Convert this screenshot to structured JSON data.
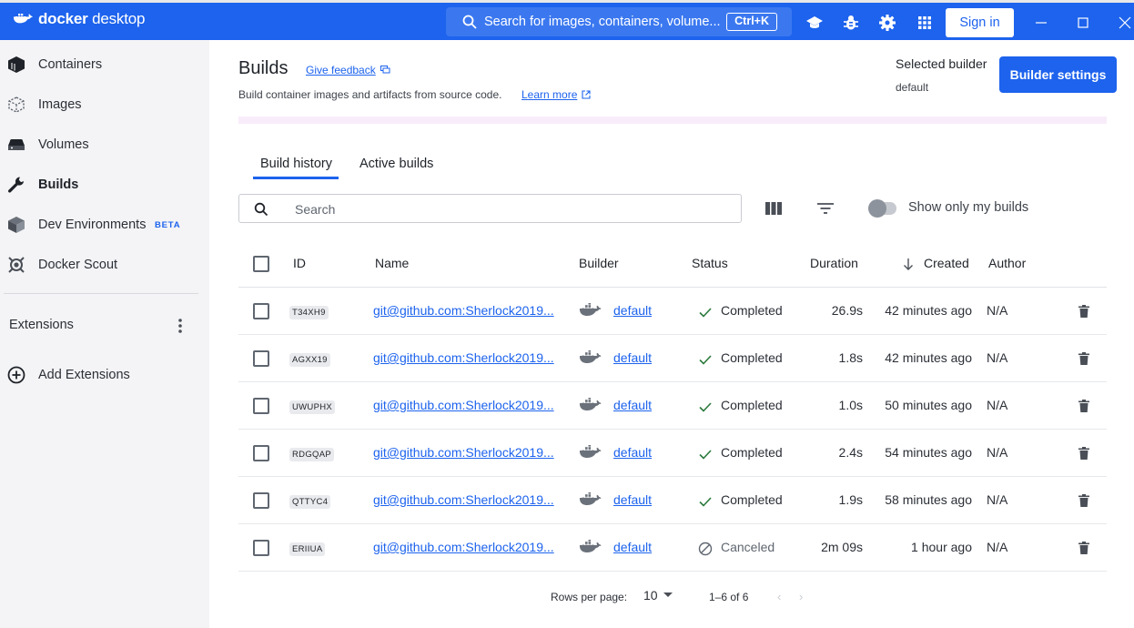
{
  "app": {
    "logo_text_bold": "docker",
    "logo_text": " desktop",
    "search_placeholder": "Search for images, containers, volume...",
    "search_shortcut": "Ctrl+K",
    "signin_label": "Sign in"
  },
  "sidebar": {
    "items": [
      {
        "label": "Containers"
      },
      {
        "label": "Images"
      },
      {
        "label": "Volumes"
      },
      {
        "label": "Builds"
      },
      {
        "label": "Dev Environments",
        "badge": "BETA"
      },
      {
        "label": "Docker Scout"
      }
    ],
    "extensions_label": "Extensions",
    "add_extensions_label": "Add Extensions"
  },
  "header": {
    "title": "Builds",
    "feedback_label": "Give feedback",
    "subtitle": "Build container images and artifacts from source code.",
    "learn_more": "Learn more",
    "selected_builder_label": "Selected builder",
    "selected_builder_value": "default",
    "builder_settings_label": "Builder settings"
  },
  "tabs": [
    {
      "label": "Build history"
    },
    {
      "label": "Active builds"
    }
  ],
  "filter": {
    "placeholder": "Search",
    "toggle_label": "Show only my builds"
  },
  "table": {
    "columns": [
      "ID",
      "Name",
      "Builder",
      "Status",
      "Duration",
      "Created",
      "Author"
    ],
    "rows": [
      {
        "id": "T34XH9",
        "name": "git@github.com:Sherlock2019...",
        "builder": "default",
        "status": "Completed",
        "duration": "26.9s",
        "created": "42 minutes ago",
        "author": "N/A"
      },
      {
        "id": "AGXX19",
        "name": "git@github.com:Sherlock2019...",
        "builder": "default",
        "status": "Completed",
        "duration": "1.8s",
        "created": "42 minutes ago",
        "author": "N/A"
      },
      {
        "id": "UWUPHX",
        "name": "git@github.com:Sherlock2019...",
        "builder": "default",
        "status": "Completed",
        "duration": "1.0s",
        "created": "50 minutes ago",
        "author": "N/A"
      },
      {
        "id": "RDGQAP",
        "name": "git@github.com:Sherlock2019...",
        "builder": "default",
        "status": "Completed",
        "duration": "2.4s",
        "created": "54 minutes ago",
        "author": "N/A"
      },
      {
        "id": "QTTYC4",
        "name": "git@github.com:Sherlock2019...",
        "builder": "default",
        "status": "Completed",
        "duration": "1.9s",
        "created": "58 minutes ago",
        "author": "N/A"
      },
      {
        "id": "ERIIUA",
        "name": "git@github.com:Sherlock2019...",
        "builder": "default",
        "status": "Canceled",
        "duration": "2m 09s",
        "created": "1 hour ago",
        "author": "N/A"
      }
    ]
  },
  "pagination": {
    "rows_per_page_label": "Rows per page:",
    "rows_per_page_value": "10",
    "range": "1–6 of 6"
  },
  "colors": {
    "brand_blue": "#1d63ed",
    "sidebar_bg": "#f4f4f6",
    "banner_purple": "#f8ecfa"
  }
}
